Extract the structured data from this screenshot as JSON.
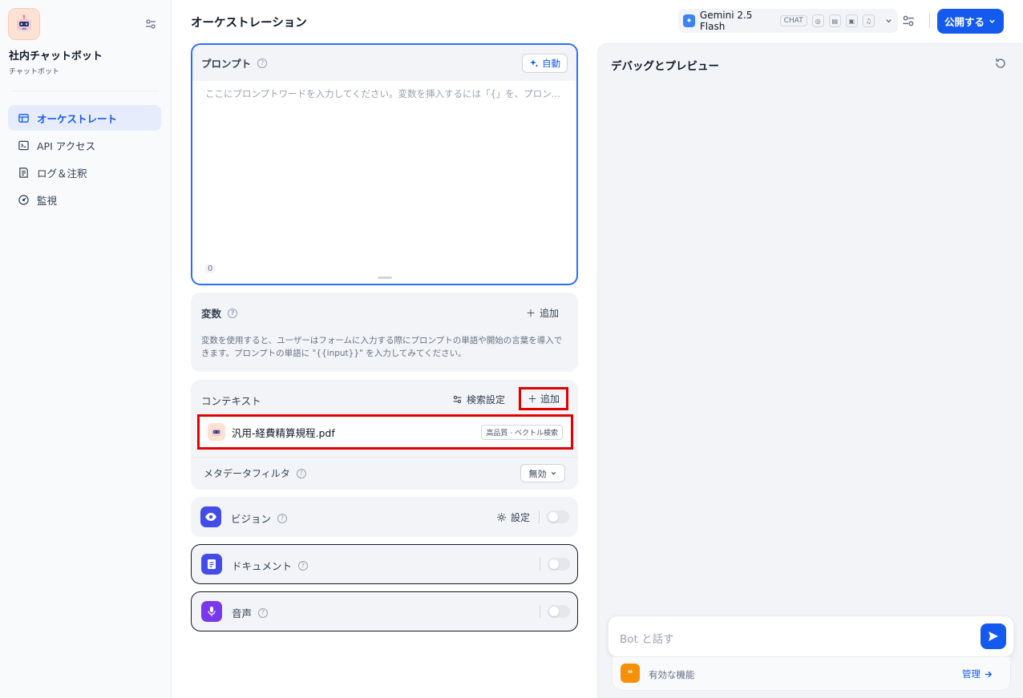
{
  "sidebar": {
    "app_name": "社内チャットボット",
    "app_type": "チャットボット",
    "items": [
      {
        "label": "オーケストレート",
        "icon": "layout-icon"
      },
      {
        "label": "API アクセス",
        "icon": "terminal-icon"
      },
      {
        "label": "ログ＆注釈",
        "icon": "document-list-icon"
      },
      {
        "label": "監視",
        "icon": "gauge-icon"
      }
    ]
  },
  "header": {
    "title": "オーケストレーション",
    "model_name": "Gemini 2.5 Flash",
    "model_mode": "CHAT",
    "publish_label": "公開する"
  },
  "prompt": {
    "title": "プロンプト",
    "auto_label": "自動",
    "placeholder": "ここにプロンプトワードを入力してください。変数を挿入するには「{」を、プロンプトコンテンツ...",
    "char_count": "0"
  },
  "variables": {
    "title": "変数",
    "add_label": "追加",
    "description": "変数を使用すると、ユーザーはフォームに入力する際にプロンプトの単語や開始の言葉を導入できます。プロンプトの単語に \"{{input}}\" を入力してみてください。"
  },
  "context": {
    "title": "コンテキスト",
    "search_settings_label": "検索設定",
    "add_label": "追加",
    "file_name": "汎用-経費精算規程.pdf",
    "file_badge": "高品質 · ベクトル検索",
    "metadata_filter_label": "メタデータフィルタ",
    "metadata_filter_value": "無効"
  },
  "features": {
    "vision_label": "ビジョン",
    "vision_settings_label": "設定",
    "document_label": "ドキュメント",
    "audio_label": "音声"
  },
  "debug": {
    "title": "デバッグとプレビュー",
    "input_placeholder": "Bot と話す",
    "enabled_features_label": "有効な機能",
    "manage_label": "管理"
  },
  "colors": {
    "accent": "#155aef",
    "highlight_outline": "#e00000",
    "vision_icon_bg": "#444ce7",
    "document_icon_bg": "#444ce7",
    "audio_icon_bg": "#7839ee",
    "features_badge_bg": "#f79009"
  }
}
